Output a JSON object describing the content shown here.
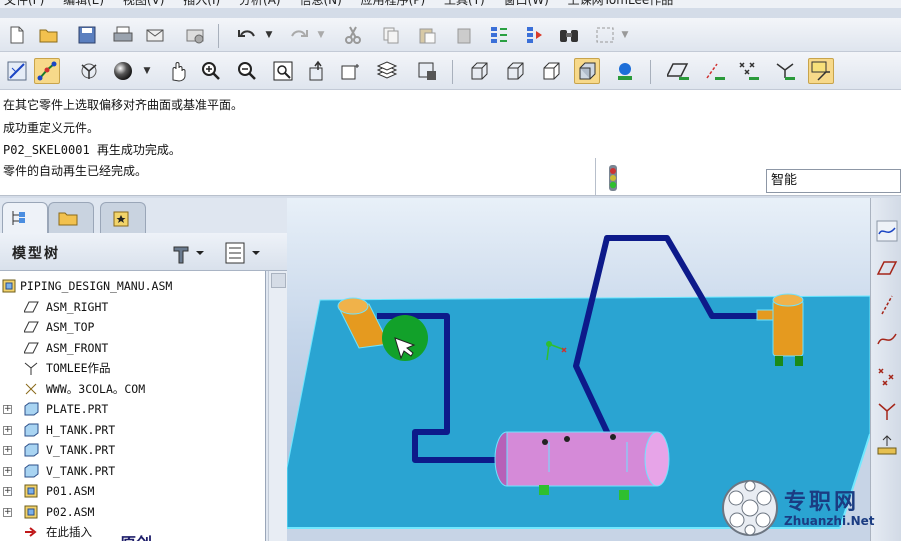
{
  "menu": [
    "文件(F)",
    "编辑(E)",
    "视图(V)",
    "插入(I)",
    "分析(A)",
    "信息(N)",
    "应用程序(P)",
    "工具(T)",
    "窗口(W)",
    "上课网TomLee作品"
  ],
  "messages": [
    "在其它零件上选取偏移对齐曲面或基准平面。",
    "成功重定义元件。",
    "P02_SKEL0001 再生成功完成。",
    "零件的自动再生已经完成。"
  ],
  "filter": {
    "value": "智能"
  },
  "panel": {
    "title": "模型树"
  },
  "tree": {
    "items": [
      {
        "label": "PIPING_DESIGN_MANU.ASM",
        "icon": "assembly-icon",
        "expandable": false
      },
      {
        "label": "ASM_RIGHT",
        "icon": "datum-plane-icon",
        "expandable": false
      },
      {
        "label": "ASM_TOP",
        "icon": "datum-plane-icon",
        "expandable": false
      },
      {
        "label": "ASM_FRONT",
        "icon": "datum-plane-icon",
        "expandable": false
      },
      {
        "label": "TOMLEE作品",
        "icon": "csys-icon",
        "expandable": false
      },
      {
        "label": "WWW。3COLA。COM",
        "icon": "note-icon",
        "expandable": false
      },
      {
        "label": "PLATE.PRT",
        "icon": "part-icon",
        "expandable": true
      },
      {
        "label": "H_TANK.PRT",
        "icon": "part-icon",
        "expandable": true
      },
      {
        "label": "V_TANK.PRT",
        "icon": "part-icon",
        "expandable": true
      },
      {
        "label": "V_TANK.PRT",
        "icon": "part-icon",
        "expandable": true
      },
      {
        "label": "P01.ASM",
        "icon": "assembly-icon",
        "expandable": true
      },
      {
        "label": "P02.ASM",
        "icon": "assembly-icon",
        "expandable": true
      },
      {
        "label": "在此插入",
        "icon": "insert-arrow-icon",
        "expandable": false
      }
    ]
  },
  "bottom_overlay": "原创",
  "watermark": {
    "cn": "专职网",
    "en": "Zhuanzhi.Net"
  },
  "colors": {
    "plate": "#2aa4d2",
    "pipe": "#0d1a8a",
    "tank": "#d58ad8",
    "vtank": "#e59a1f",
    "selection": "#12a12a"
  }
}
